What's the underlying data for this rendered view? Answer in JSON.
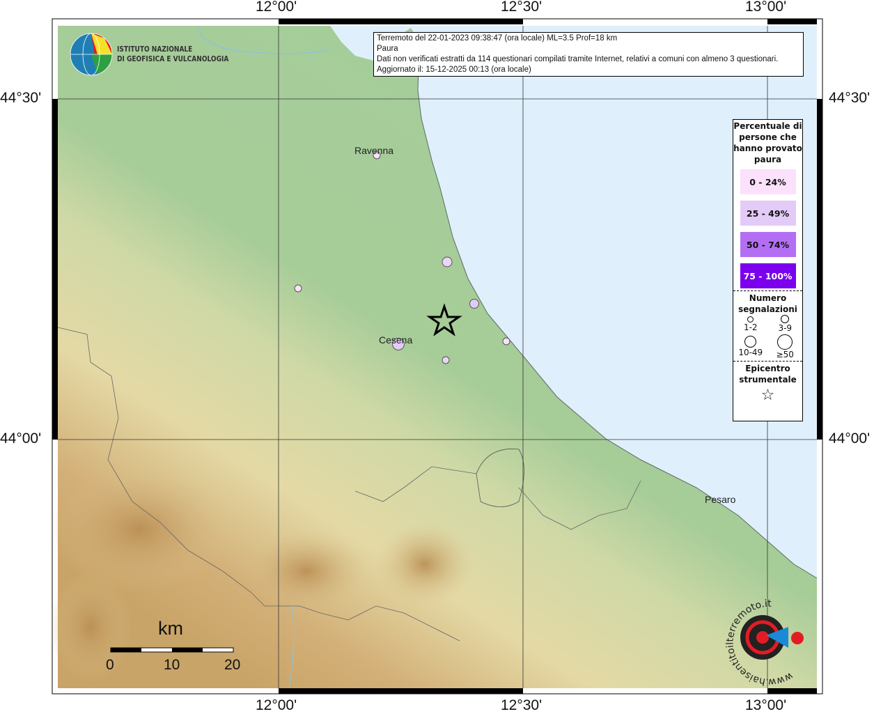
{
  "info": {
    "line1": "Terremoto del 22-01-2023 09:38:47 (ora locale) ML=3.5 Prof=18 km",
    "line2": "Paura",
    "line3": "Dati non verificati estratti da 114 questionari compilati tramite Internet, relativi a comuni con almeno 3 questionari.",
    "line4": "Aggiornato il: 15-12-2025 00:13 (ora locale)"
  },
  "axes": {
    "lon": [
      "12°00'",
      "12°30'",
      "13°00'"
    ],
    "lat": [
      "44°30'",
      "44°00'"
    ]
  },
  "logo": {
    "line1": "ISTITUTO NAZIONALE",
    "line2": "DI GEOFISICA E VULCANOLOGIA"
  },
  "badge": {
    "text": "www.haisentitoilterremoto.it"
  },
  "cities": [
    "Ravenna",
    "Cesena",
    "Pesaro"
  ],
  "legend": {
    "title": "Percentuale di persone che hanno provato paura",
    "classes": [
      {
        "label": "0 - 24%",
        "color": "#fbe1fb"
      },
      {
        "label": "25 - 49%",
        "color": "#e4cbf7"
      },
      {
        "label": "50 - 74%",
        "color": "#b46ef4"
      },
      {
        "label": "75 - 100%",
        "color": "#7a00ee"
      }
    ],
    "count_title": "Numero segnalazioni",
    "counts": [
      "1-2",
      "3-9",
      "10-49",
      "≥50"
    ],
    "epicenter_title": "Epicentro strumentale"
  },
  "scale": {
    "unit": "km",
    "ticks": [
      "0",
      "10",
      "20"
    ]
  },
  "colors": {
    "sea": "#dff0fc",
    "plain": "#a8cf9c",
    "hill": "#e5dca7",
    "mountain": "#c29a5d"
  }
}
